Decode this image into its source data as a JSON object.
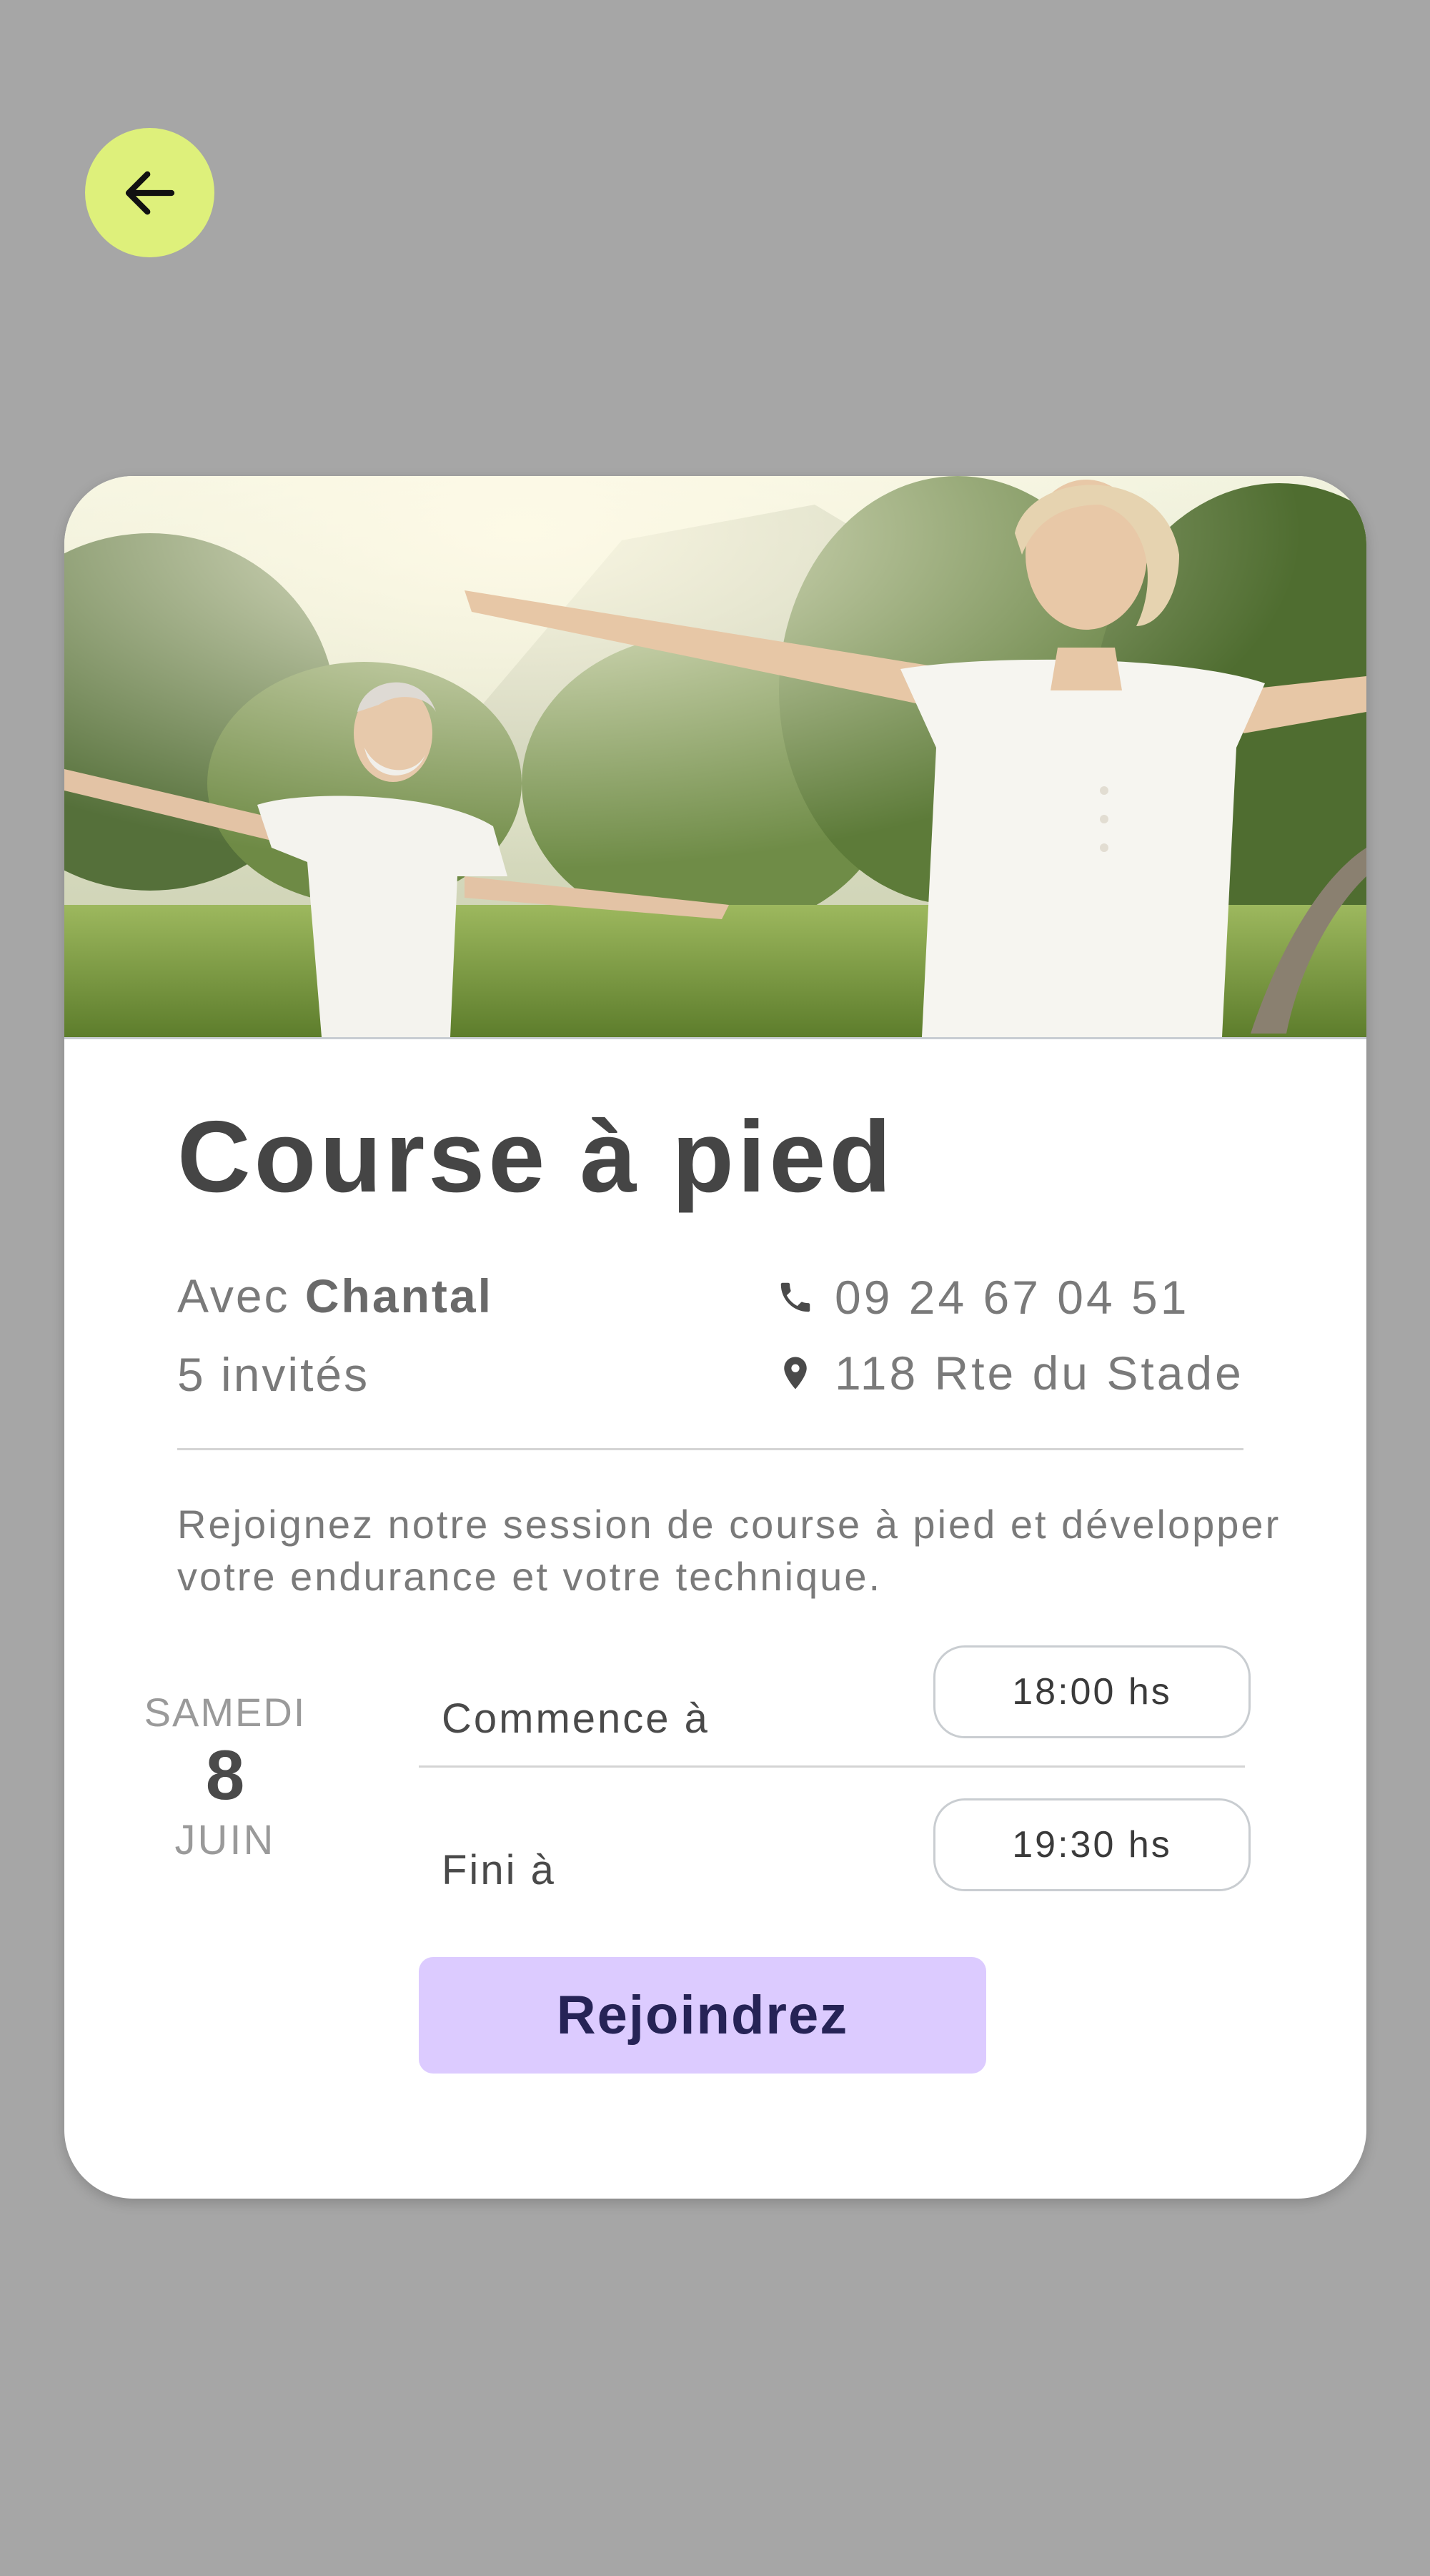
{
  "nav": {
    "back_icon": "arrow-left-icon",
    "back_color": "#def07b"
  },
  "event": {
    "title": "Course à pied",
    "host_prefix": "Avec",
    "host_name": "Chantal",
    "guests": "5 invités",
    "phone": "09 24 67 04 51",
    "address": "118 Rte du Stade",
    "description": "Rejoignez notre session de course à pied et développer votre endurance et votre technique.",
    "date": {
      "weekday": "SAMEDI",
      "day": "8",
      "month": "JUIN"
    },
    "start": {
      "label": "Commence à",
      "time": "18:00 hs"
    },
    "end": {
      "label": "Fini à",
      "time": "19:30 hs"
    },
    "join_label": "Rejoindrez"
  },
  "colors": {
    "background": "#a6a6a6",
    "join_button": "#dccbff",
    "join_text": "#262356"
  },
  "icons": {
    "phone": "phone-icon",
    "location": "location-pin-icon"
  }
}
